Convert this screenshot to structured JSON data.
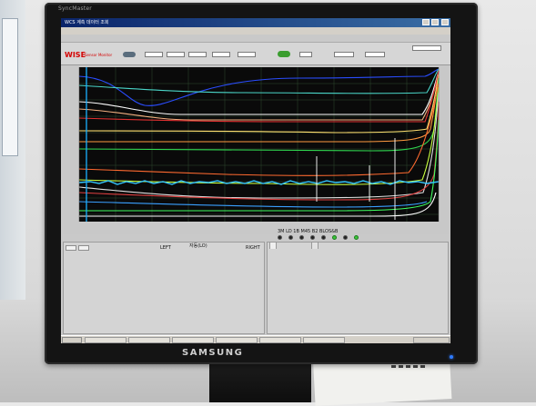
{
  "monitor": {
    "brand": "SAMSUNG",
    "model_badge": "SyncMaster"
  },
  "app": {
    "title": "WCS 계측 데이터 조회",
    "logo": "WISE",
    "logo_sub": "Sensor Monitor"
  },
  "plot": {
    "background": "#0a0a0a",
    "grid_color": "#3a5c3a"
  },
  "indicators": {
    "label": "3M  LD  1B  M45  B2  BLOS&B",
    "lamps": [
      false,
      false,
      false,
      false,
      false,
      true,
      false,
      true
    ]
  },
  "lower": {
    "left_header": "LEFT",
    "center_header": "자동(LO)",
    "right_header": "RIGHT"
  },
  "colors": {
    "screen_bg": "#c9c9c9",
    "bezel": "#141414",
    "logo": "#d40000"
  }
}
